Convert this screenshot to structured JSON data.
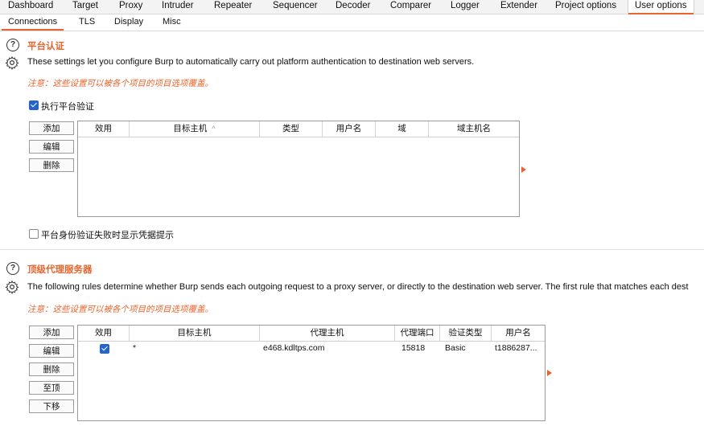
{
  "top_tabs": [
    "Dashboard",
    "Target",
    "Proxy",
    "Intruder",
    "Repeater",
    "Sequencer",
    "Decoder",
    "Comparer",
    "Logger",
    "Extender",
    "Project options",
    "User options"
  ],
  "active_top_tab": "User options",
  "sub_tabs": [
    "Connections",
    "TLS",
    "Display",
    "Misc"
  ],
  "platform_auth": {
    "title": "平台认证",
    "description": "These settings let you configure Burp to automatically carry out platform authentication to destination web servers.",
    "note": "注意：这些设置可以被各个项目的项目选项覆盖。",
    "enable_label": "执行平台验证",
    "buttons": {
      "add": "添加",
      "edit": "编辑",
      "remove": "删除"
    },
    "columns": [
      "效用",
      "目标主机",
      "类型",
      "用户名",
      "域",
      "域主机名"
    ],
    "sort_indicator": "^",
    "prompt_label": "平台身份验证失败时显示凭据提示"
  },
  "upstream_proxy": {
    "title": "顶级代理服务器",
    "description": "The following rules determine whether Burp sends each outgoing request to a proxy server, or directly to the destination web server. The first rule that matches each dest",
    "note": "注意：这些设置可以被各个项目的项目选项覆盖。",
    "buttons": {
      "add": "添加",
      "edit": "编辑",
      "remove": "删除",
      "up": "至顶",
      "down": "下移"
    },
    "columns": [
      "效用",
      "目标主机",
      "代理主机",
      "代理端口",
      "验证类型",
      "用户名"
    ],
    "rows": [
      {
        "enabled": true,
        "host": "*",
        "proxy_host": "e468.kdltps.com",
        "proxy_port": "15818",
        "auth_type": "Basic",
        "username": "t1886287..."
      }
    ]
  },
  "colors": {
    "accent": "#e8642c",
    "checkbox": "#2565c9"
  },
  "icons": [
    "help-icon",
    "gear-icon",
    "sort-arrow-icon",
    "expand-arrow-icon"
  ]
}
